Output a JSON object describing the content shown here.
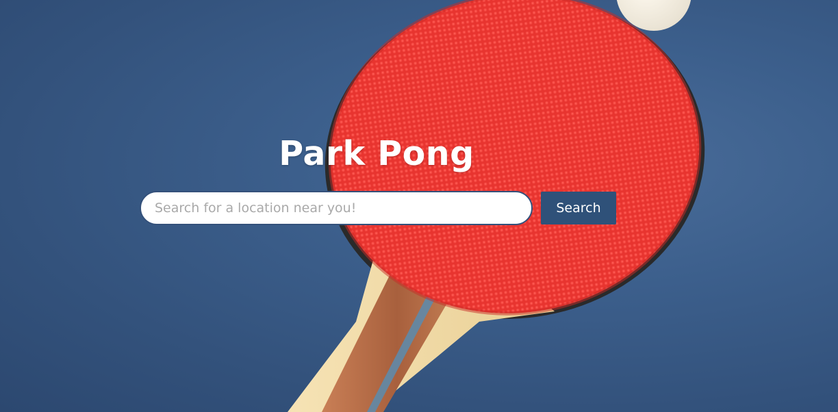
{
  "page": {
    "title": "Park Pong"
  },
  "search": {
    "placeholder": "Search for a location near you!",
    "value": "",
    "button_label": "Search"
  },
  "colors": {
    "background": "#3c5f8c",
    "paddle_rubber": "#e8332e",
    "button": "#2f5179",
    "title_text": "#ffffff"
  }
}
